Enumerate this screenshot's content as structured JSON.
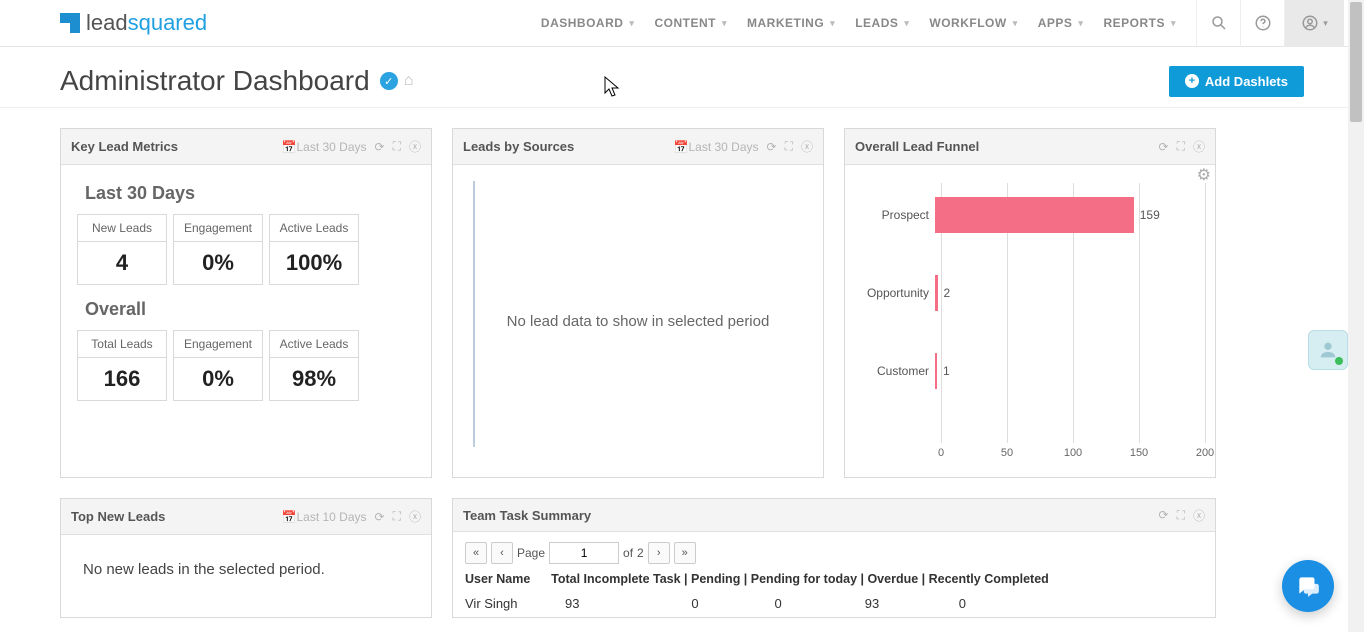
{
  "logo": {
    "part1": "lead",
    "part2": "squared"
  },
  "nav": [
    "DASHBOARD",
    "CONTENT",
    "MARKETING",
    "LEADS",
    "WORKFLOW",
    "APPS",
    "REPORTS"
  ],
  "page": {
    "title": "Administrator Dashboard"
  },
  "add_dashlets": "Add Dashlets",
  "dashlets": {
    "key_metrics": {
      "title": "Key Lead Metrics",
      "period": "Last 30 Days",
      "section1_title": "Last 30 Days",
      "section2_title": "Overall",
      "last30": {
        "new_leads_h": "New Leads",
        "new_leads_v": "4",
        "engagement_h": "Engagement",
        "engagement_v": "0%",
        "active_h": "Active Leads",
        "active_v": "100%"
      },
      "overall": {
        "total_h": "Total Leads",
        "total_v": "166",
        "engagement_h": "Engagement",
        "engagement_v": "0%",
        "active_h": "Active Leads",
        "active_v": "98%"
      }
    },
    "leads_sources": {
      "title": "Leads by Sources",
      "period": "Last 30 Days",
      "empty_msg": "No lead data to show in selected period"
    },
    "funnel": {
      "title": "Overall Lead Funnel"
    },
    "top_leads": {
      "title": "Top New Leads",
      "period": "Last 10 Days",
      "empty_msg": "No new leads in the selected period."
    },
    "tasks": {
      "title": "Team Task Summary",
      "pager": {
        "page_label": "Page",
        "page": "1",
        "of_label": "of",
        "total": "2"
      },
      "header": "User Name      Total Incomplete Task | Pending | Pending for today | Overdue | Recently Completed",
      "row1_user": "Vir Singh",
      "row1_vals": "93                               0                     0                       93                      0"
    }
  },
  "chart_data": {
    "type": "bar",
    "orientation": "horizontal",
    "categories": [
      "Prospect",
      "Opportunity",
      "Customer"
    ],
    "values": [
      159,
      2,
      1
    ],
    "title": "Overall Lead Funnel",
    "xlabel": "",
    "ylabel": "",
    "xlim": [
      0,
      200
    ],
    "x_ticks": [
      0,
      50,
      100,
      150,
      200
    ],
    "bar_color": "#f46f85"
  }
}
